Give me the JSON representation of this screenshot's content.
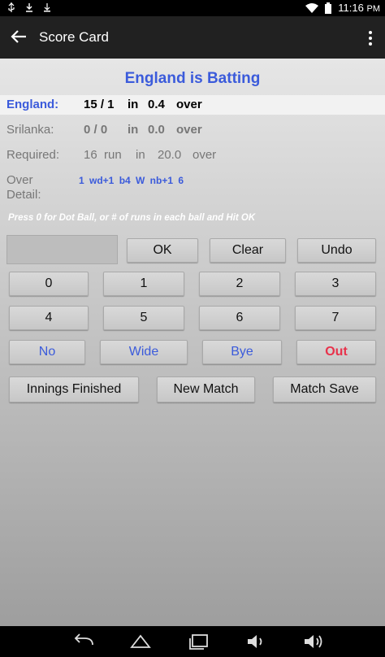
{
  "statusbar": {
    "time": "11:16",
    "time_suffix": "PM"
  },
  "actionbar": {
    "title": "Score Card"
  },
  "batting_title": "England is Batting",
  "batting": {
    "team": "England:",
    "score": "15 / 1",
    "in": "in",
    "overs": "0.4",
    "over": "over"
  },
  "bowling": {
    "team": "Srilanka:",
    "score": "0 / 0",
    "in": "in",
    "overs": "0.0",
    "over": "over"
  },
  "required": {
    "label": "Required:",
    "runs": "16",
    "run": "run",
    "in": "in",
    "overs": "20.0",
    "over": "over"
  },
  "over_detail": {
    "label_line1": "Over",
    "label_line2": "Detail:",
    "balls": "1  wd+1  b4  W  nb+1  6"
  },
  "hint": "Press 0 for Dot Ball, or # of runs in each ball and Hit OK",
  "entry": {
    "value": ""
  },
  "buttons": {
    "ok": "OK",
    "clear": "Clear",
    "undo": "Undo",
    "n0": "0",
    "n1": "1",
    "n2": "2",
    "n3": "3",
    "n4": "4",
    "n5": "5",
    "n6": "6",
    "n7": "7",
    "no": "No",
    "wide": "Wide",
    "bye": "Bye",
    "out": "Out",
    "innings_finished": "Innings Finished",
    "new_match": "New Match",
    "match_save": "Match Save"
  },
  "colors": {
    "accent_blue": "#3b5bdb",
    "out_red": "#e8324b",
    "actionbar": "#212121"
  }
}
